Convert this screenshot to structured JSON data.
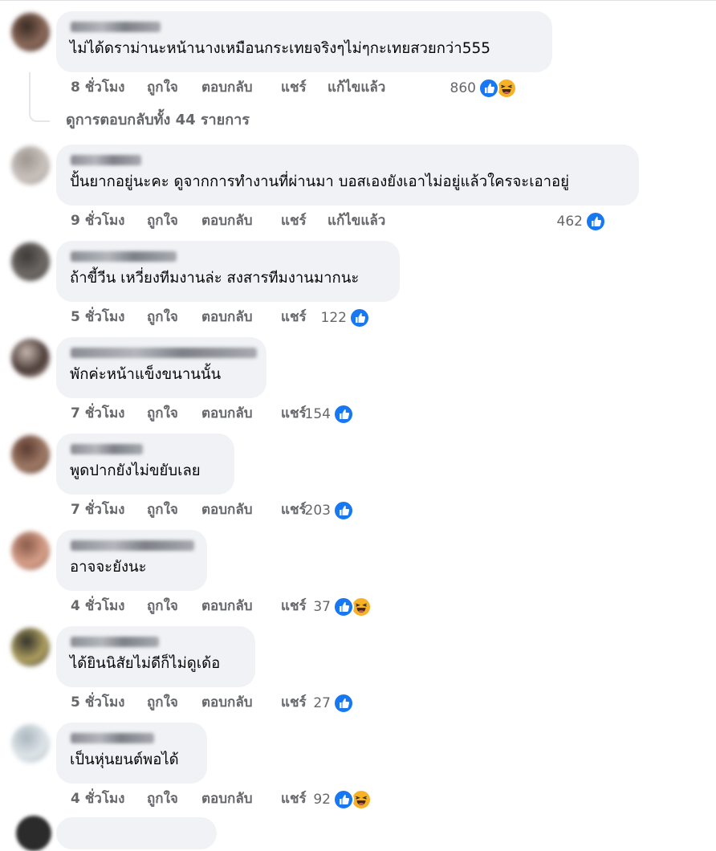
{
  "view_replies_label": "ดูการตอบกลับทั้ง 44 รายการ",
  "action_labels": {
    "like": "ถูกใจ",
    "reply": "ตอบกลับ",
    "share": "แชร์",
    "edited": "แก้ไขแล้ว"
  },
  "reaction_icons": {
    "like": "like-icon",
    "haha": "haha-icon"
  },
  "colors": {
    "bubble": "#f0f2f5",
    "meta_text": "#65676b",
    "like_blue": "#1877f2",
    "haha_yellow": "#f7b125"
  },
  "comments": [
    {
      "author": "(blurred name)",
      "text": "ไม่ได้ดราม่านะหน้านางเหมือนกระเทยจริงๆไม่ๆกะเทยสวยกว่า555",
      "time": "8 ชั่วโมง",
      "edited": true,
      "reaction_count": "860",
      "reactions": [
        "like",
        "haha"
      ]
    },
    {
      "author": "(blurred name)",
      "text": "ปั้นยากอยู่นะคะ ดูจากการทำงานที่ผ่านมา บอสเองยังเอาไม่อยู่แล้วใครจะเอาอยู่",
      "time": "9 ชั่วโมง",
      "edited": true,
      "reaction_count": "462",
      "reactions": [
        "like"
      ]
    },
    {
      "author": "(blurred name)",
      "text": "ถ้าขี้วีน เหวี่ยงทีมงานล่ะ สงสารทีมงานมากนะ",
      "time": "5 ชั่วโมง",
      "edited": false,
      "reaction_count": "122",
      "reactions": [
        "like"
      ]
    },
    {
      "author": "(blurred name)",
      "text": "พักค่ะหน้าแข็งขนานนั้น",
      "time": "7 ชั่วโมง",
      "edited": false,
      "reaction_count": "154",
      "reactions": [
        "like"
      ]
    },
    {
      "author": "(blurred name)",
      "text": "พูดปากยังไม่ขยับเลย",
      "time": "7 ชั่วโมง",
      "edited": false,
      "reaction_count": "203",
      "reactions": [
        "like"
      ]
    },
    {
      "author": "(blurred name)",
      "text": "อาจจะยังนะ",
      "time": "4 ชั่วโมง",
      "edited": false,
      "reaction_count": "37",
      "reactions": [
        "like",
        "haha"
      ]
    },
    {
      "author": "(blurred name)",
      "text": "ได้ยินนิสัยไม่ดีก็ไม่ดูเด้อ",
      "time": "5 ชั่วโมง",
      "edited": false,
      "reaction_count": "27",
      "reactions": [
        "like"
      ]
    },
    {
      "author": "(blurred name)",
      "text": "เป็นหุ่นยนต์พอได้",
      "time": "4 ชั่วโมง",
      "edited": false,
      "reaction_count": "92",
      "reactions": [
        "like",
        "haha"
      ]
    }
  ]
}
